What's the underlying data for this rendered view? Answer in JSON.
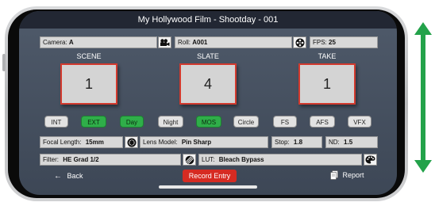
{
  "titlebar": {
    "title": "My Hollywood Film - Shootday - 001"
  },
  "row1": {
    "camera_label": "Camera:",
    "camera_value": "A",
    "roll_label": "Roll:",
    "roll_value": "A001",
    "fps_label": "FPS:",
    "fps_value": "25"
  },
  "columns": {
    "scene_label": "SCENE",
    "scene_value": "1",
    "slate_label": "SLATE",
    "slate_value": "4",
    "take_label": "TAKE",
    "take_value": "1"
  },
  "toggles": [
    {
      "label": "INT",
      "on": false
    },
    {
      "label": "EXT",
      "on": true
    },
    {
      "label": "Day",
      "on": true
    },
    {
      "label": "Night",
      "on": false
    },
    {
      "label": "MOS",
      "on": true
    },
    {
      "label": "Circle",
      "on": false
    },
    {
      "label": "FS",
      "on": false
    },
    {
      "label": "AFS",
      "on": false
    },
    {
      "label": "VFX",
      "on": false
    }
  ],
  "row3": {
    "focal_label": "Focal Length:",
    "focal_value": "15mm",
    "lens_label": "Lens Model:",
    "lens_value": "Pin Sharp",
    "stop_label": "Stop:",
    "stop_value": "1.8",
    "nd_label": "ND:",
    "nd_value": "1.5"
  },
  "row4": {
    "filter_label": "Filter:",
    "filter_value": "HE Grad 1/2",
    "lut_label": "LUT:",
    "lut_value": "Bleach Bypass"
  },
  "bottom": {
    "back_label": "Back",
    "record_label": "Record Entry",
    "report_label": "Report"
  },
  "colors": {
    "accent_on": "#2fae49",
    "record": "#d62b22",
    "counter_border": "#d23a2e",
    "arrow": "#23a24a"
  },
  "icons": [
    "camera-icon",
    "film-reel-icon",
    "lens-aperture-icon",
    "filter-icon",
    "palette-icon",
    "back-arrow-icon",
    "report-icon",
    "vertical-arrow-icon"
  ]
}
